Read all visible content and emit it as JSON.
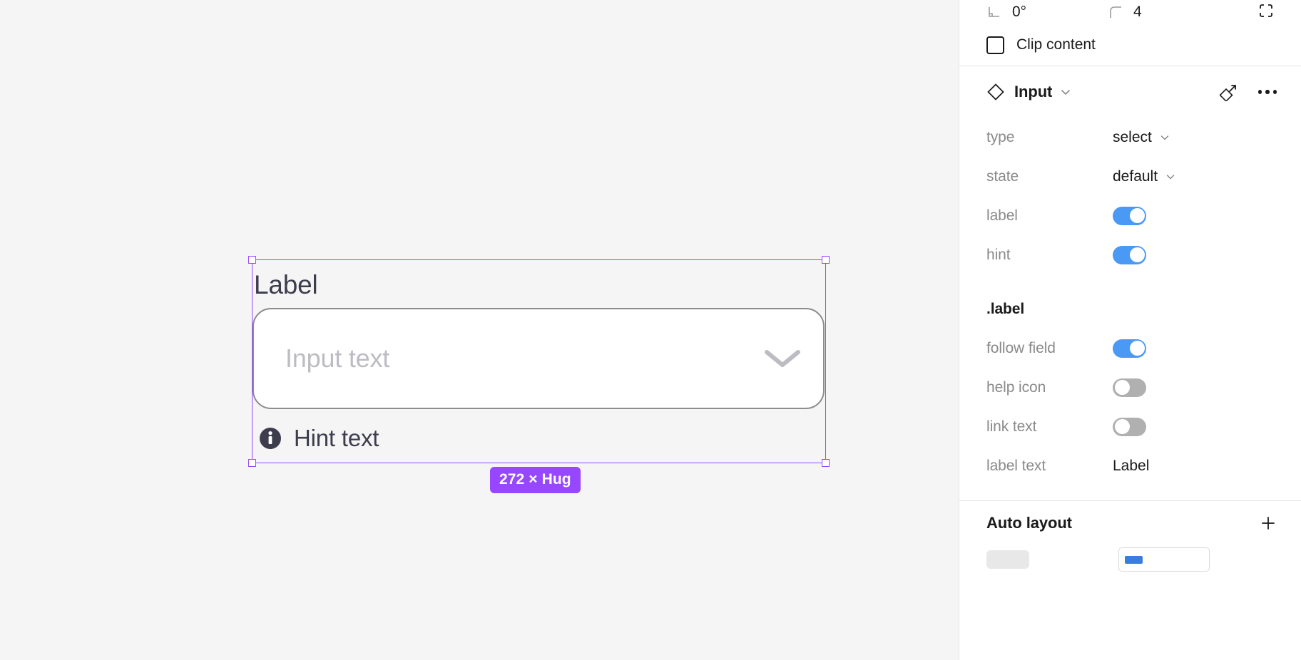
{
  "canvas": {
    "background_color": "#f5f5f5",
    "selection_color": "#9747ff",
    "component": {
      "label_text": "Label",
      "placeholder_text": "Input text",
      "hint_text": "Hint text",
      "dropdown_icon": "chevron-down-icon",
      "hint_icon": "info-icon"
    },
    "size_badge": "272 × Hug"
  },
  "panel": {
    "geometry": {
      "rotation_icon": "angle-icon",
      "rotation_value": "0°",
      "corner_radius_icon": "corner-radius-icon",
      "corner_radius_value": "4",
      "independent_corners_icon": "independent-corners-icon"
    },
    "clip_content": {
      "label": "Clip content",
      "checked": false,
      "checkbox_icon": "checkbox-icon"
    },
    "component_header": {
      "icon": "component-diamond-icon",
      "title": "Input",
      "caret_icon": "chevron-down-icon",
      "detach_icon": "detach-instance-icon",
      "more_icon": "more-options-icon"
    },
    "properties": [
      {
        "name": "type",
        "kind": "select",
        "value": "select",
        "caret_icon": "chevron-down-icon"
      },
      {
        "name": "state",
        "kind": "select",
        "value": "default",
        "caret_icon": "chevron-down-icon"
      },
      {
        "name": "label",
        "kind": "toggle",
        "on": true
      },
      {
        "name": "hint",
        "kind": "toggle",
        "on": true
      }
    ],
    "label_group": {
      "title": ".label",
      "properties": [
        {
          "name": "follow field",
          "kind": "toggle",
          "on": true
        },
        {
          "name": "help icon",
          "kind": "toggle",
          "on": false
        },
        {
          "name": "link text",
          "kind": "toggle",
          "on": false
        },
        {
          "name": "label text",
          "kind": "text",
          "value": "Label"
        }
      ]
    },
    "auto_layout": {
      "title": "Auto layout",
      "add_icon": "plus-icon"
    },
    "colors": {
      "toggle_on": "#4a9af5",
      "toggle_off": "#b0b0b0",
      "accent": "#9747ff"
    }
  }
}
